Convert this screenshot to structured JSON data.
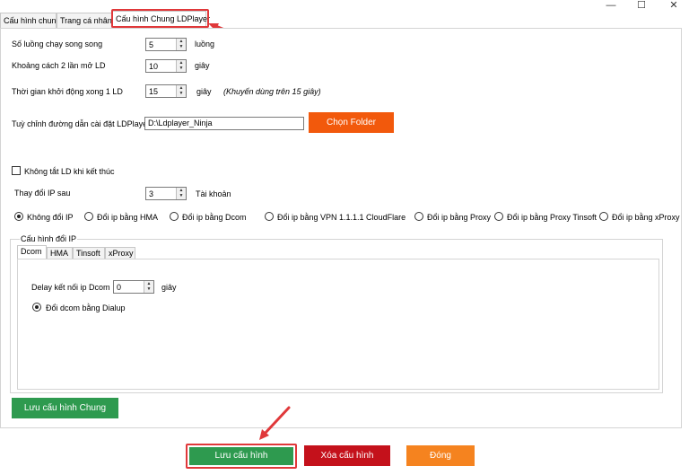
{
  "window": {
    "minimize": "—",
    "maximize": "☐",
    "close": "✕"
  },
  "tabs": [
    {
      "label": "Cấu hình chung"
    },
    {
      "label": "Trang cá nhân"
    },
    {
      "label": "Cấu hình Chung LDPlayer"
    }
  ],
  "settings": {
    "threads_label": "Số luồng chạy song song",
    "threads_value": "5",
    "threads_unit": "luồng",
    "interval_label": "Khoảng cách 2 lần mở LD",
    "interval_value": "10",
    "interval_unit": "giây",
    "boot_label": "Thời gian khởi động xong 1 LD",
    "boot_value": "15",
    "boot_unit": "giây",
    "boot_hint": "(Khuyến dùng trên 15 giây)",
    "path_label": "Tuỳ chỉnh đường dẫn cài đặt LDPlayer",
    "path_value": "D:\\Ldplayer_Ninja",
    "folder_button": "Chọn Folder",
    "keep_ld_label": "Không tắt LD khi kết thúc",
    "change_ip_label": "Thay đổi IP sau",
    "change_ip_value": "3",
    "change_ip_unit": "Tài khoản"
  },
  "ip_options": [
    {
      "label": "Không đổi IP",
      "selected": true
    },
    {
      "label": "Đổi ip bằng HMA",
      "selected": false
    },
    {
      "label": "Đổi ip bằng Dcom",
      "selected": false
    },
    {
      "label": "Đổi ip bằng VPN 1.1.1.1 CloudFlare",
      "selected": false
    },
    {
      "label": "Đổi ip bằng Proxy",
      "selected": false
    },
    {
      "label": "Đổi ip bằng Proxy Tinsoft",
      "selected": false
    },
    {
      "label": "Đổi ip bằng xProxy",
      "selected": false
    }
  ],
  "ip_config": {
    "group_label": "Cấu hình đổi IP",
    "subtabs": [
      {
        "label": "Dcom"
      },
      {
        "label": "HMA"
      },
      {
        "label": "Tinsoft"
      },
      {
        "label": "xProxy"
      }
    ],
    "delay_label": "Delay kết nối ip Dcom",
    "delay_value": "0",
    "delay_unit": "giây",
    "dialup_label": "Đổi dcom bằng Dialup"
  },
  "buttons": {
    "save_general": "Lưu cấu hình Chung",
    "save": "Lưu cấu hình",
    "delete": "Xóa cấu hình",
    "close": "Đóng"
  },
  "colors": {
    "green": "#2e9a4f",
    "red": "#c4111b",
    "orange": "#f5831f",
    "folder_orange": "#f2590c",
    "annotation_red": "#e0383a"
  }
}
